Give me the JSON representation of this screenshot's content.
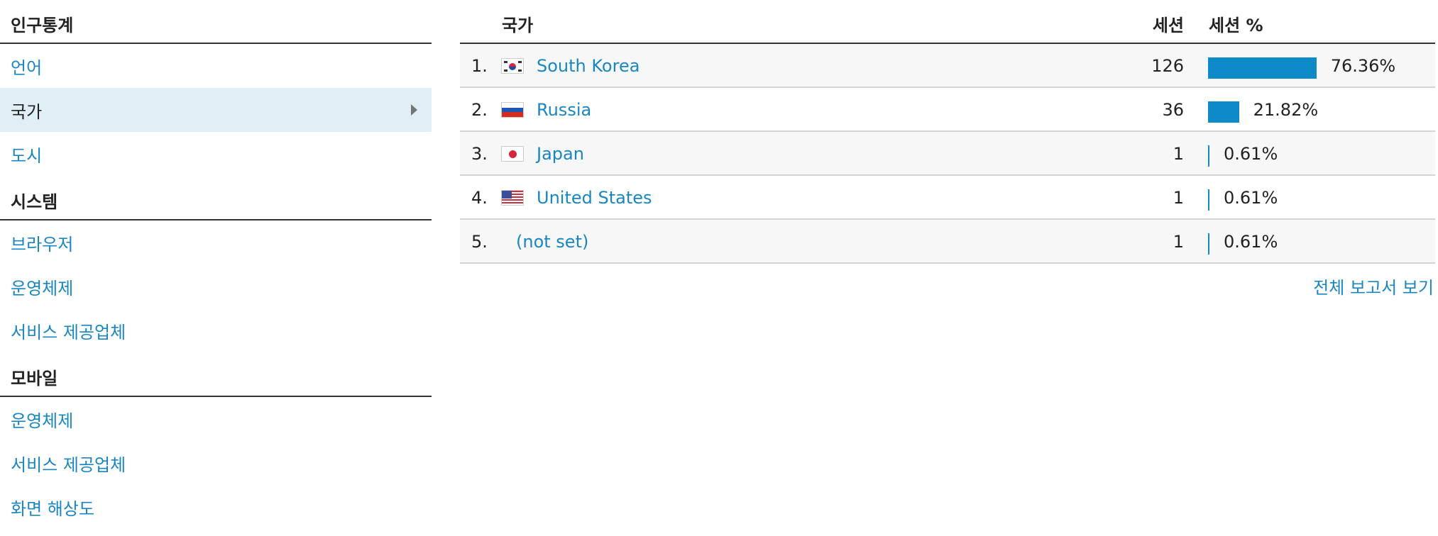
{
  "sidebar": {
    "sections": [
      {
        "title": "인구통계",
        "items": [
          {
            "label": "언어",
            "selected": false
          },
          {
            "label": "국가",
            "selected": true
          },
          {
            "label": "도시",
            "selected": false
          }
        ]
      },
      {
        "title": "시스템",
        "items": [
          {
            "label": "브라우저",
            "selected": false
          },
          {
            "label": "운영체제",
            "selected": false
          },
          {
            "label": "서비스 제공업체",
            "selected": false
          }
        ]
      },
      {
        "title": "모바일",
        "items": [
          {
            "label": "운영체제",
            "selected": false
          },
          {
            "label": "서비스 제공업체",
            "selected": false
          },
          {
            "label": "화면 해상도",
            "selected": false
          }
        ]
      }
    ]
  },
  "table": {
    "headers": {
      "country": "국가",
      "sessions": "세션",
      "sessions_pct": "세션 %"
    },
    "rows": [
      {
        "rank": "1.",
        "flag": "south-korea-flag-icon",
        "country": "South Korea",
        "sessions": "126",
        "pct_label": "76.36%",
        "pct": 76.36
      },
      {
        "rank": "2.",
        "flag": "russia-flag-icon",
        "country": "Russia",
        "sessions": "36",
        "pct_label": "21.82%",
        "pct": 21.82
      },
      {
        "rank": "3.",
        "flag": "japan-flag-icon",
        "country": "Japan",
        "sessions": "1",
        "pct_label": "0.61%",
        "pct": 0.61
      },
      {
        "rank": "4.",
        "flag": "united-states-flag-icon",
        "country": "United States",
        "sessions": "1",
        "pct_label": "0.61%",
        "pct": 0.61
      },
      {
        "rank": "5.",
        "flag": null,
        "country": "(not set)",
        "sessions": "1",
        "pct_label": "0.61%",
        "pct": 0.61
      }
    ],
    "full_report_label": "전체 보고서 보기"
  },
  "colors": {
    "link": "#1a86c1",
    "bar": "#0f8ac8",
    "selected_bg": "#e0eef6"
  }
}
